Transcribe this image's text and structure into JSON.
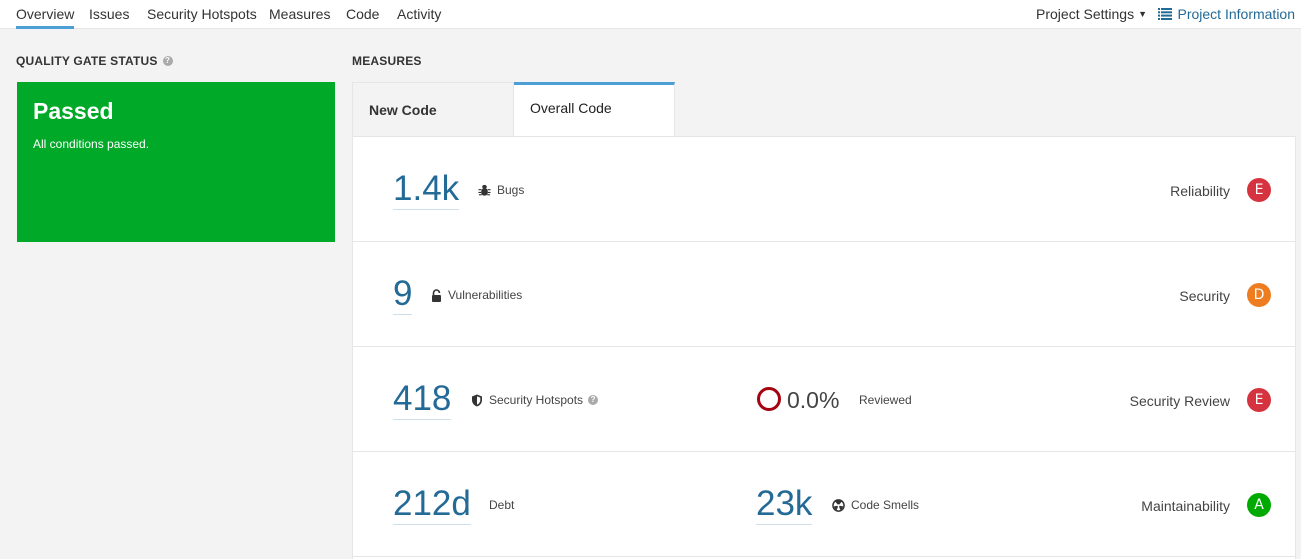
{
  "nav": {
    "tabs": [
      {
        "label": "Overview",
        "active": true
      },
      {
        "label": "Issues"
      },
      {
        "label": "Security Hotspots"
      },
      {
        "label": "Measures"
      },
      {
        "label": "Code"
      },
      {
        "label": "Activity"
      }
    ],
    "project_settings": "Project Settings",
    "project_information": "Project Information"
  },
  "quality_gate": {
    "title": "QUALITY GATE STATUS",
    "status": "Passed",
    "message": "All conditions passed.",
    "color": "#00aa28"
  },
  "measures": {
    "title": "MEASURES",
    "tabs": {
      "new_code": "New Code",
      "overall_code": "Overall Code"
    },
    "reliability": {
      "value": "1.4k",
      "label": "Bugs",
      "rating_label": "Reliability",
      "rating": "E",
      "rating_color": "#d4333f"
    },
    "security": {
      "value": "9",
      "label": "Vulnerabilities",
      "rating_label": "Security",
      "rating": "D",
      "rating_color": "#ed7d20"
    },
    "hotspots": {
      "value": "418",
      "label": "Security Hotspots",
      "reviewed_pct": "0.0%",
      "reviewed_label": "Reviewed",
      "rating_label": "Security Review",
      "rating": "E",
      "rating_color": "#d4333f"
    },
    "maintainability": {
      "value": "212d",
      "label": "Debt",
      "smells_value": "23k",
      "smells_label": "Code Smells",
      "rating_label": "Maintainability",
      "rating": "A",
      "rating_color": "#00aa00"
    }
  }
}
